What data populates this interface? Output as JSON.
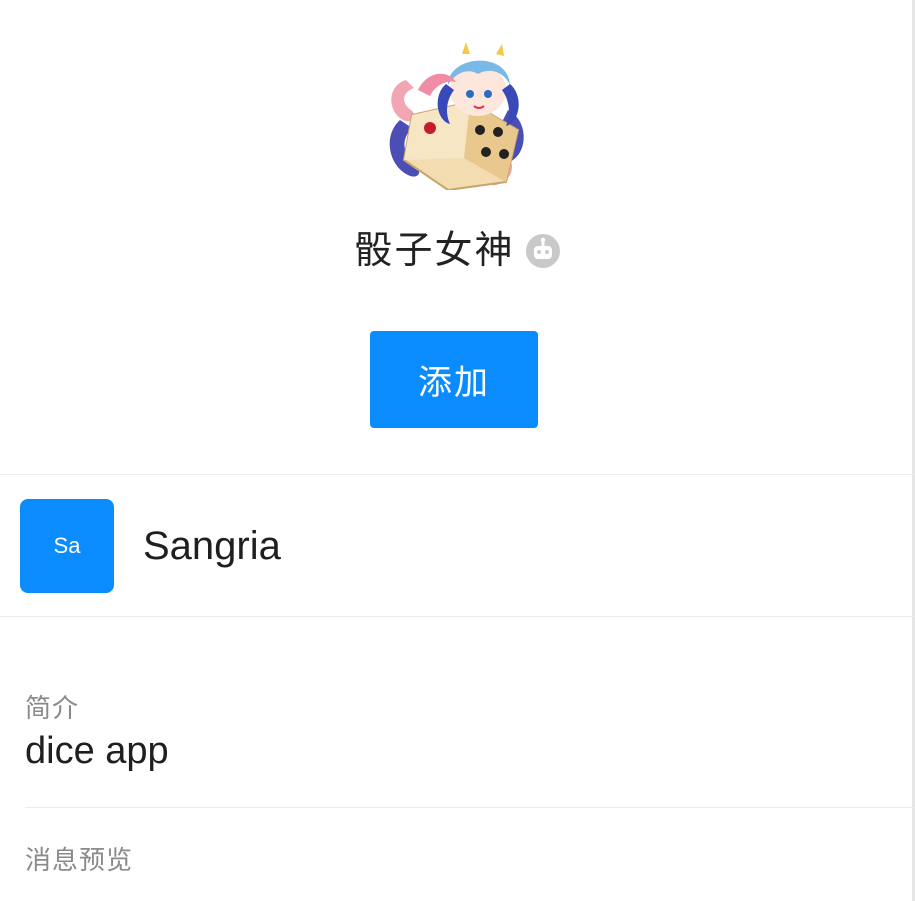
{
  "profile": {
    "name": "骰子女神",
    "avatar_icon": "dice-goddess-avatar",
    "bot_badge_icon": "robot-icon"
  },
  "actions": {
    "add_label": "添加"
  },
  "owner": {
    "avatar_initials": "Sa",
    "name": "Sangria"
  },
  "intro": {
    "label": "简介",
    "value": "dice app"
  },
  "preview": {
    "label": "消息预览"
  },
  "colors": {
    "accent": "#0a8cff",
    "label_gray": "#8a8a8a",
    "divider": "#ececec"
  }
}
